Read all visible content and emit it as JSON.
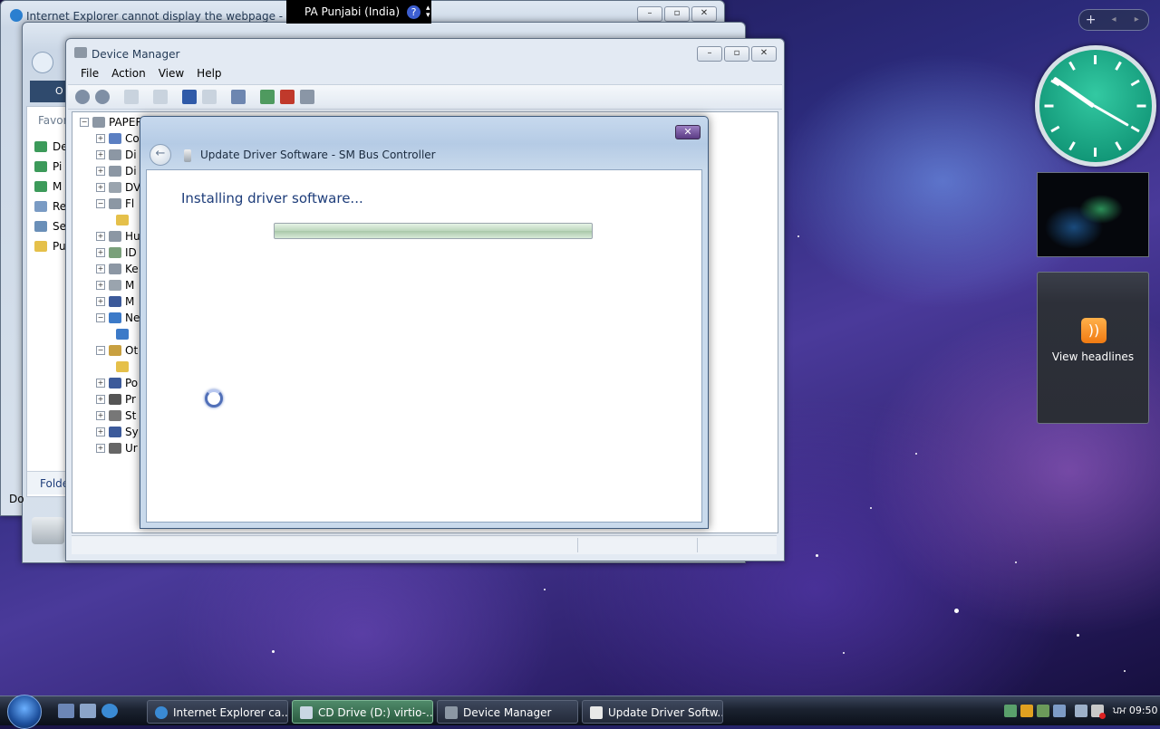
{
  "language_bar": {
    "label": "PA Punjabi (India)",
    "help": "?"
  },
  "ie_window": {
    "title": "Internet Explorer cannot display the webpage - Windo"
  },
  "explorer_window": {
    "nav_tab": "O",
    "favorites": "Favor",
    "links": [
      "De",
      "Pi",
      "M",
      "Re",
      "Se",
      "Pu"
    ],
    "folders": "Folde",
    "status": "Do"
  },
  "device_manager": {
    "title": "Device Manager",
    "menu": [
      "File",
      "Action",
      "View",
      "Help"
    ],
    "root": "PAPER",
    "tree": [
      {
        "text": "Co",
        "exp": "+"
      },
      {
        "text": "Di",
        "exp": "+"
      },
      {
        "text": "Di",
        "exp": "+"
      },
      {
        "text": "DV",
        "exp": "+"
      },
      {
        "text": "Fl",
        "exp": "−"
      },
      {
        "text": "",
        "exp": ""
      },
      {
        "text": "Hu",
        "exp": "+"
      },
      {
        "text": "ID",
        "exp": "+"
      },
      {
        "text": "Ke",
        "exp": "+"
      },
      {
        "text": "M",
        "exp": "+"
      },
      {
        "text": "M",
        "exp": "+"
      },
      {
        "text": "Ne",
        "exp": "−"
      },
      {
        "text": "",
        "exp": ""
      },
      {
        "text": "Ot",
        "exp": "−"
      },
      {
        "text": "",
        "exp": ""
      },
      {
        "text": "Po",
        "exp": "+"
      },
      {
        "text": "Pr",
        "exp": "+"
      },
      {
        "text": "St",
        "exp": "+"
      },
      {
        "text": "Sy",
        "exp": "+"
      },
      {
        "text": "Ur",
        "exp": "+"
      }
    ]
  },
  "dialog": {
    "title": "Update Driver Software - SM Bus Controller",
    "heading": "Installing driver software...",
    "progress": 1.0,
    "close": "✕"
  },
  "gadgets": {
    "feed_label": "View headlines",
    "sidebar_add": "+"
  },
  "taskbar": {
    "tasks": [
      {
        "label": "Internet Explorer ca..."
      },
      {
        "label": "CD Drive (D:) virtio-..."
      },
      {
        "label": "Device Manager"
      },
      {
        "label": "Update Driver Softw..."
      }
    ],
    "clock": "ਪਮ 09:50"
  },
  "colors": {
    "accent": "#1e3d7a",
    "clock_face": "#07876a",
    "rss": "#f07a12"
  }
}
